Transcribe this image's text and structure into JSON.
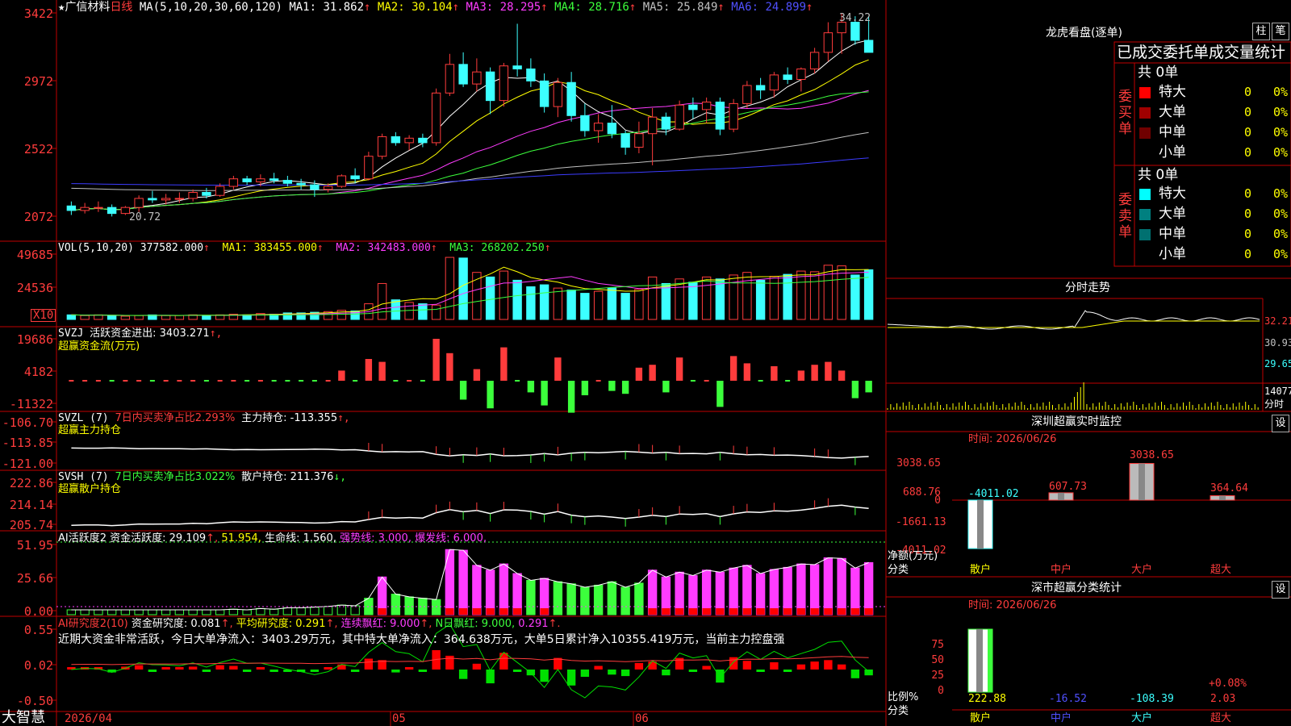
{
  "app": {
    "logo": "大智慧"
  },
  "colors": {
    "up": "#ff3c3c",
    "down": "#3cffff",
    "grid": "#c00000",
    "ma5": "#ffffff",
    "ma10": "#ffff00",
    "ma20": "#ff3cff",
    "ma30": "#3cff3c",
    "ma60": "#c0c0c0",
    "ma120": "#3c3cff"
  },
  "main": {
    "star": "★",
    "stock": "广信材料",
    "period": "日线",
    "ma_title": "MA(5,10,20,30,60,120)",
    "ma": [
      {
        "label": "MA1: 31.862",
        "arrow": "↑"
      },
      {
        "label": "MA2: 30.104",
        "arrow": "↑"
      },
      {
        "label": "MA3: 28.295",
        "arrow": "↑"
      },
      {
        "label": "MA4: 28.716",
        "arrow": "↑"
      },
      {
        "label": "MA5: 25.849",
        "arrow": "↑"
      },
      {
        "label": "MA6: 24.899",
        "arrow": "↑"
      }
    ],
    "yticks": [
      "3422",
      "2972",
      "2522",
      "2072"
    ],
    "high_label": "34.22",
    "low_label": "20.72"
  },
  "vol": {
    "title": "VOL(5,10,20)",
    "val": "377582.000",
    "arrow": "↑",
    "ma": [
      {
        "label": "MA1: 383455.000",
        "arrow": "↑"
      },
      {
        "label": "MA2: 342483.000",
        "arrow": "↑"
      },
      {
        "label": "MA3: 268202.250",
        "arrow": "↑"
      }
    ],
    "yticks": [
      "49685",
      "24536"
    ],
    "unit": "X10"
  },
  "svzj": {
    "title": "SVZJ",
    "label": "活跃资金进出: 3403.271",
    "arrow": "↑,",
    "sub": "超赢资金流(万元)",
    "yticks": [
      "19686",
      "4182",
      "-11322"
    ]
  },
  "svzl": {
    "title": "SVZL (7)",
    "pct": "7日内买卖净占比2.293%",
    "label": "主力持仓: -113.355",
    "arrow": "↑,",
    "sub": "超赢主力持仓",
    "yticks": [
      "-106.70",
      "-113.85",
      "-121.00"
    ]
  },
  "svsh": {
    "title": "SVSH (7)",
    "pct": "7日内买卖净占比3.022%",
    "label": "散户持仓: 211.376",
    "arrow": "↓,",
    "sub": "超赢散户持仓",
    "yticks": [
      "222.86",
      "214.14",
      "205.74"
    ]
  },
  "ai1": {
    "title": "AI活跃度2",
    "l1": "资金活跃度: 29.109",
    "a1": "↑,",
    "l2": "51.954,",
    "l3": "生命线: 1.560,",
    "l4": "强势线: 3.000,",
    "l5": "爆发线: 6.000,",
    "yticks": [
      "51.95",
      "25.66",
      "0.00"
    ]
  },
  "ai2": {
    "title": "AI研究度2(10)",
    "l1": "资金研究度: 0.081",
    "a1": "↑,",
    "l2": "平均研究度: 0.291",
    "a2": "↑,",
    "l3": "连续飘红: 9.000",
    "a3": "↑,",
    "l4": "N日飘红: 9.000,",
    "l5": "0.291",
    "a5": "↑.",
    "comment": "近期大资金非常活跃，今日大单净流入：3403.29万元，其中特大单净流入：364.638万元，大单5日累计净入10355.419万元，当前主力控盘强",
    "yticks": [
      "0.55",
      "0.02",
      "-0.50"
    ]
  },
  "xaxis": {
    "labels": [
      "2026/04",
      "05",
      "06"
    ]
  },
  "panel": {
    "title": "龙虎看盘(逐单)",
    "btn1": "柱",
    "btn2": "笔",
    "header": "已成交委托单成交量统计",
    "buy": {
      "side": "委买单",
      "total": "共 0单",
      "rows": [
        {
          "name": "特大",
          "count": "0",
          "pct": "0%",
          "color": "#ff0000"
        },
        {
          "name": "大单",
          "count": "0",
          "pct": "0%",
          "color": "#a00000"
        },
        {
          "name": "中单",
          "count": "0",
          "pct": "0%",
          "color": "#700000"
        },
        {
          "name": "小单",
          "count": "0",
          "pct": "0%",
          "color": ""
        }
      ]
    },
    "sell": {
      "side": "委卖单",
      "total": "共 0单",
      "rows": [
        {
          "name": "特大",
          "count": "0",
          "pct": "0%",
          "color": "#00ffff"
        },
        {
          "name": "大单",
          "count": "0",
          "pct": "0%",
          "color": "#008080"
        },
        {
          "name": "中单",
          "count": "0",
          "pct": "0%",
          "color": "#007070"
        },
        {
          "name": "小单",
          "count": "0",
          "pct": "0%",
          "color": ""
        }
      ]
    },
    "fenshi": {
      "title": "分时走势",
      "yticks": [
        "32.21",
        "30.93",
        "29.65"
      ],
      "vol_label": "14077",
      "vol_unit": "分时"
    },
    "monitor": {
      "title": "深圳超赢实时监控",
      "btn": "设",
      "time": "时间: 2026/06/26",
      "yticks": [
        "3038.65",
        "688.76",
        "0",
        "-1661.13",
        "-4011.02"
      ],
      "ylabel": "净额(万元)",
      "xlabel": "分类",
      "cats": [
        "散户",
        "中户",
        "大户",
        "超大"
      ],
      "values": [
        -4011.02,
        607.73,
        3038.65,
        364.64
      ],
      "value_labels": [
        "-4011.02",
        "607.73",
        "3038.65",
        "364.64"
      ]
    },
    "stats": {
      "title": "深市超赢分类统计",
      "btn": "设",
      "time": "时间: 2026/06/26",
      "yticks": [
        "75",
        "50",
        "25",
        "0"
      ],
      "ylabel": "比例%",
      "xlabel": "分类",
      "cats": [
        "散户",
        "中户",
        "大户",
        "超大"
      ],
      "values": [
        "222.88",
        "-16.52",
        "-108.39",
        "2.03"
      ],
      "pct_label": "+0.08%"
    }
  },
  "chart_data": {
    "type": "candlestick",
    "ylim": [
      20.72,
      34.22
    ],
    "candles": [
      [
        21.4,
        21.7,
        20.8,
        21.1
      ],
      [
        21.1,
        21.6,
        20.9,
        21.3
      ],
      [
        21.3,
        21.7,
        21.0,
        21.3
      ],
      [
        21.3,
        21.5,
        20.7,
        20.9
      ],
      [
        20.9,
        21.4,
        20.8,
        21.3
      ],
      [
        21.3,
        22.1,
        21.0,
        21.9
      ],
      [
        21.9,
        22.4,
        21.6,
        21.8
      ],
      [
        21.8,
        22.2,
        21.5,
        21.9
      ],
      [
        21.9,
        22.3,
        21.6,
        21.9
      ],
      [
        21.9,
        22.5,
        21.7,
        22.3
      ],
      [
        22.3,
        22.6,
        21.9,
        22.1
      ],
      [
        22.1,
        22.9,
        22.0,
        22.7
      ],
      [
        22.7,
        23.4,
        22.5,
        23.2
      ],
      [
        23.2,
        23.4,
        22.8,
        23.0
      ],
      [
        23.0,
        23.5,
        22.7,
        23.2
      ],
      [
        23.2,
        23.6,
        22.9,
        23.1
      ],
      [
        23.1,
        23.4,
        22.7,
        22.9
      ],
      [
        22.9,
        23.2,
        22.5,
        22.8
      ],
      [
        22.8,
        23.1,
        22.0,
        22.5
      ],
      [
        22.5,
        22.9,
        22.3,
        22.7
      ],
      [
        22.7,
        23.5,
        22.6,
        23.4
      ],
      [
        23.4,
        23.9,
        22.9,
        23.2
      ],
      [
        23.2,
        25.0,
        23.1,
        24.7
      ],
      [
        24.7,
        26.2,
        24.5,
        26.0
      ],
      [
        26.0,
        26.3,
        25.4,
        25.6
      ],
      [
        25.6,
        26.1,
        25.1,
        25.9
      ],
      [
        25.9,
        26.2,
        25.3,
        25.6
      ],
      [
        25.6,
        29.2,
        25.4,
        28.9
      ],
      [
        28.9,
        31.5,
        28.7,
        30.8
      ],
      [
        30.8,
        31.6,
        29.3,
        29.5
      ],
      [
        29.5,
        31.2,
        29.0,
        30.3
      ],
      [
        30.3,
        30.6,
        27.5,
        28.4
      ],
      [
        28.4,
        30.9,
        28.0,
        30.7
      ],
      [
        30.7,
        33.5,
        30.0,
        30.5
      ],
      [
        30.5,
        31.2,
        29.3,
        29.7
      ],
      [
        29.7,
        30.2,
        27.6,
        28.0
      ],
      [
        28.0,
        29.9,
        27.3,
        29.6
      ],
      [
        29.6,
        30.3,
        27.0,
        27.4
      ],
      [
        27.4,
        28.2,
        26.0,
        26.4
      ],
      [
        26.4,
        27.5,
        25.6,
        26.9
      ],
      [
        26.9,
        28.1,
        25.9,
        26.2
      ],
      [
        26.2,
        26.4,
        24.8,
        25.3
      ],
      [
        25.3,
        27.0,
        24.9,
        26.2
      ],
      [
        26.2,
        27.9,
        24.1,
        27.3
      ],
      [
        27.3,
        27.6,
        26.1,
        26.5
      ],
      [
        26.5,
        28.4,
        26.4,
        28.1
      ],
      [
        28.1,
        28.6,
        27.2,
        27.8
      ],
      [
        27.8,
        28.6,
        26.9,
        28.3
      ],
      [
        28.3,
        28.6,
        26.1,
        26.5
      ],
      [
        26.5,
        28.5,
        26.3,
        28.2
      ],
      [
        28.2,
        29.7,
        27.9,
        29.4
      ],
      [
        29.4,
        29.9,
        28.5,
        29.1
      ],
      [
        29.1,
        30.3,
        28.6,
        30.1
      ],
      [
        30.1,
        30.6,
        29.5,
        29.8
      ],
      [
        29.8,
        30.6,
        29.0,
        30.5
      ],
      [
        30.5,
        31.9,
        30.2,
        31.6
      ],
      [
        31.6,
        33.6,
        31.0,
        32.9
      ],
      [
        32.9,
        34.22,
        31.5,
        33.6
      ],
      [
        33.6,
        34.0,
        32.1,
        32.4
      ],
      [
        32.4,
        34.0,
        32.2,
        31.6
      ]
    ],
    "volume": [
      0.07,
      0.06,
      0.07,
      0.06,
      0.05,
      0.06,
      0.07,
      0.06,
      0.06,
      0.07,
      0.06,
      0.07,
      0.08,
      0.07,
      0.09,
      0.08,
      0.1,
      0.1,
      0.11,
      0.12,
      0.14,
      0.13,
      0.24,
      0.55,
      0.3,
      0.26,
      0.24,
      0.22,
      0.95,
      0.94,
      0.72,
      0.65,
      0.74,
      0.6,
      0.5,
      0.53,
      0.48,
      0.45,
      0.4,
      0.43,
      0.48,
      0.4,
      0.46,
      0.65,
      0.55,
      0.62,
      0.57,
      0.65,
      0.62,
      0.68,
      0.72,
      0.6,
      0.66,
      0.69,
      0.74,
      0.73,
      0.83,
      0.82,
      0.68,
      0.76
    ]
  }
}
